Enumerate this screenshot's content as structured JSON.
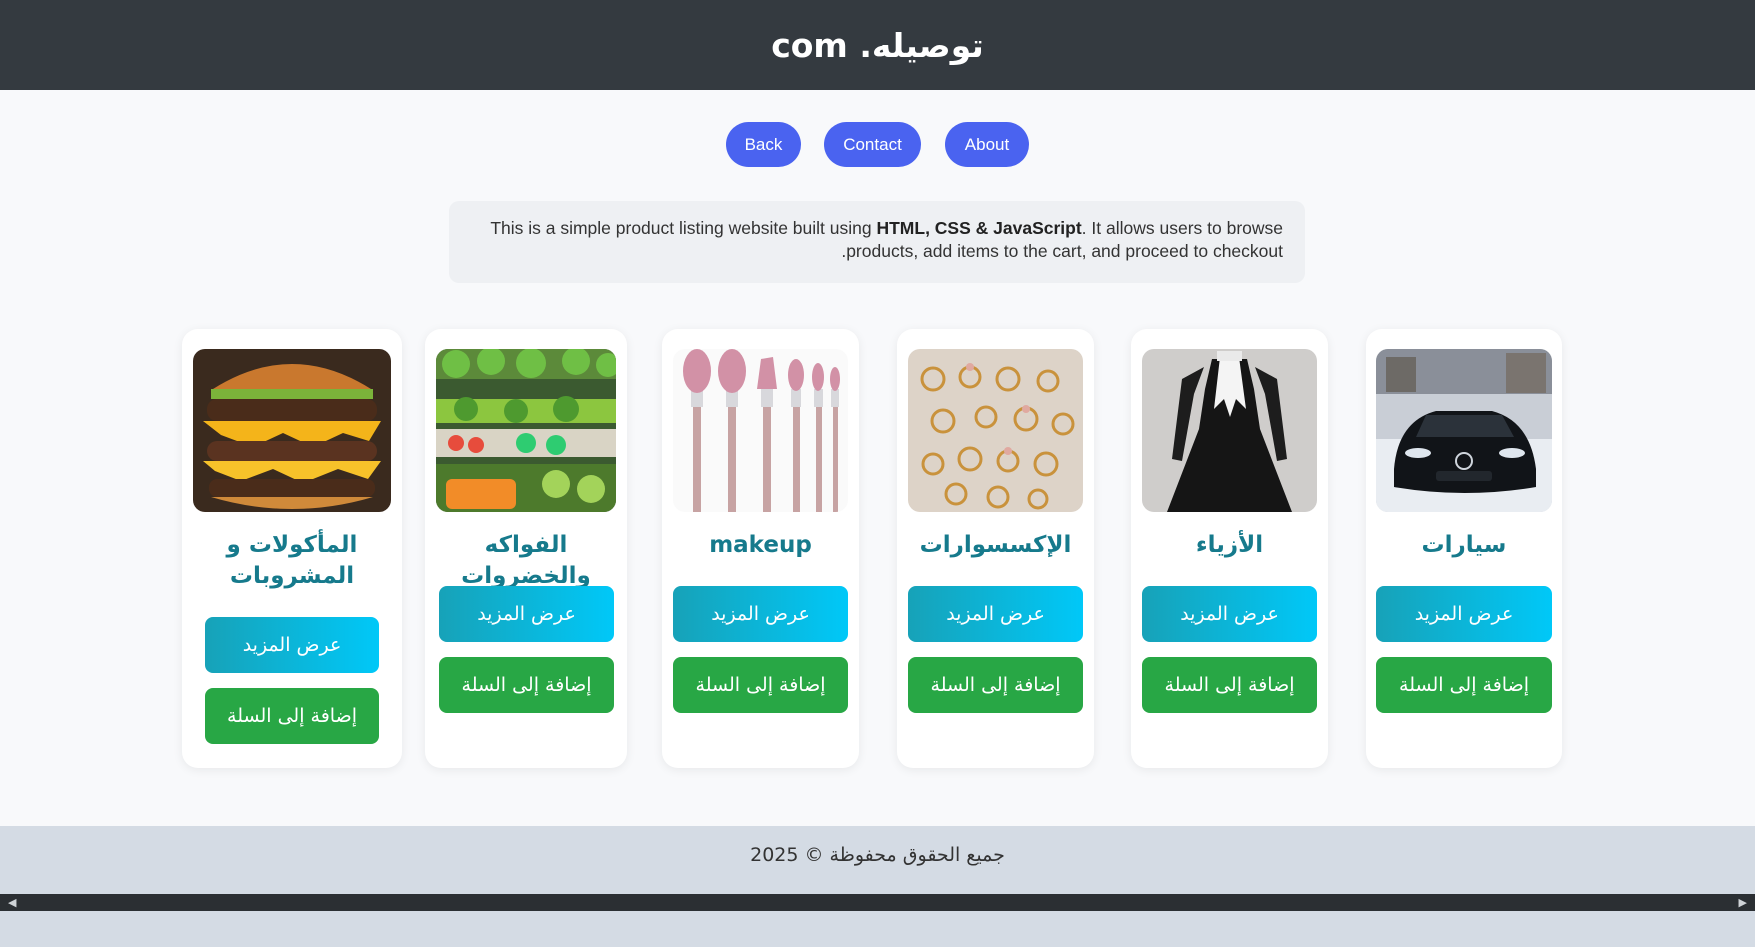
{
  "header": {
    "title": "توصيله. com"
  },
  "nav": {
    "back": "Back",
    "contact": "Contact",
    "about": "About"
  },
  "intro": {
    "part1": "This is a simple product listing website built using ",
    "bold": "HTML, CSS & JavaScript",
    "part2": ". It allows users to browse products, add items to the cart, and proceed to checkout."
  },
  "products": [
    {
      "title": "سيارات",
      "image": "car",
      "more_label": "عرض المزيد",
      "cart_label": "إضافة إلى السلة"
    },
    {
      "title": "الأزياء",
      "image": "dress",
      "more_label": "عرض المزيد",
      "cart_label": "إضافة إلى السلة"
    },
    {
      "title": "الإكسسوارات",
      "image": "rings",
      "more_label": "عرض المزيد",
      "cart_label": "إضافة إلى السلة"
    },
    {
      "title": "makeup",
      "image": "makeup-brushes",
      "more_label": "عرض المزيد",
      "cart_label": "إضافة إلى السلة"
    },
    {
      "title": "الفواكه والخضروات",
      "image": "vegetables",
      "more_label": "عرض المزيد",
      "cart_label": "إضافة إلى السلة"
    },
    {
      "title": "المأكولات و المشروبات",
      "image": "burger",
      "more_label": "عرض المزيد",
      "cart_label": "إضافة إلى السلة"
    }
  ],
  "footer": {
    "text": "جميع الحقوق محفوظة © 2025"
  },
  "colors": {
    "header_bg": "#343a40",
    "nav_button": "#4a63f0",
    "more_button": "#17a2b8",
    "cart_button": "#28a745",
    "title_color": "#167a8c"
  }
}
